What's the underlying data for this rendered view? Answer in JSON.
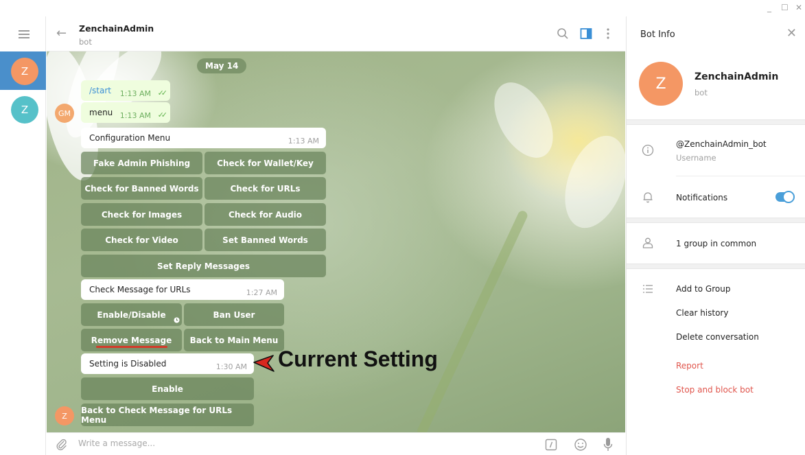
{
  "window": {
    "minimize": "_",
    "maximize": "☐",
    "close": "✕"
  },
  "sidebar": {
    "chats": [
      {
        "initial": "Z",
        "color": "#f49764"
      },
      {
        "initial": "Z",
        "color": "#56c1c9"
      }
    ]
  },
  "header": {
    "title": "ZenchainAdmin",
    "subtitle": "bot"
  },
  "messages": {
    "date": "May 14",
    "start": {
      "text": "/start",
      "time": "1:13 AM"
    },
    "menu": {
      "text": "menu",
      "time": "1:13 AM",
      "sender_initials": "GM"
    },
    "config": {
      "text": "Configuration Menu",
      "time": "1:13 AM",
      "buttons": [
        "Fake Admin Phishing",
        "Check for Wallet/Key",
        "Check for Banned Words",
        "Check for URLs",
        "Check for Images",
        "Check for Audio",
        "Check for Video",
        "Set Banned Words",
        "Set Reply Messages"
      ]
    },
    "urls": {
      "text": "Check Message for URLs",
      "time": "1:27 AM",
      "buttons": [
        "Enable/Disable",
        "Ban User",
        "Remove Message",
        "Back to Main Menu"
      ]
    },
    "setting": {
      "text": "Setting is Disabled",
      "time": "1:30 AM",
      "buttons": [
        "Enable",
        "Back to Check Message for URLs Menu"
      ],
      "sender_initials": "Z"
    },
    "annotation": "Current Setting"
  },
  "composer": {
    "placeholder": "Write a message..."
  },
  "bot_info": {
    "title": "Bot Info",
    "avatar_initial": "Z",
    "name": "ZenchainAdmin",
    "subtitle": "bot",
    "username": "@ZenchainAdmin_bot",
    "username_label": "Username",
    "notifications_label": "Notifications",
    "notifications_on": true,
    "groups_in_common": "1 group in common",
    "actions": [
      "Add to Group",
      "Clear history",
      "Delete conversation"
    ],
    "danger_actions": [
      "Report",
      "Stop and block bot"
    ]
  },
  "colors": {
    "accent": "#4a9fd9",
    "danger": "#e0554c",
    "keyboard_button": "#69845c"
  }
}
